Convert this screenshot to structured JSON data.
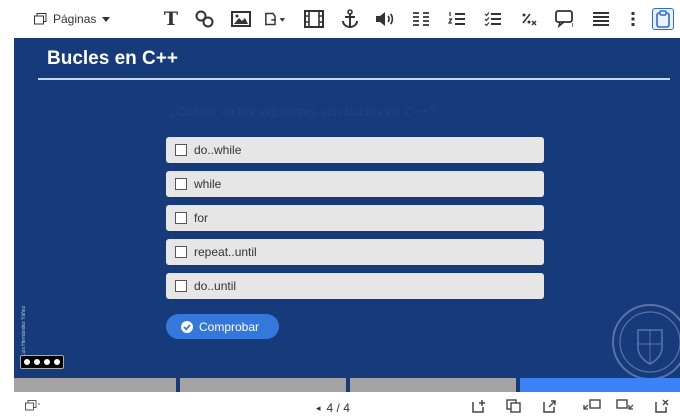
{
  "toolbar": {
    "pages_label": "Páginas",
    "text_tool_label": "T"
  },
  "slide": {
    "title": "Bucles en C++",
    "question": "¿Cuáles de los siguientes son bucles en C++?",
    "options": [
      {
        "label": "do..while"
      },
      {
        "label": "while"
      },
      {
        "label": "for"
      },
      {
        "label": "repeat..until"
      },
      {
        "label": "do..until"
      }
    ],
    "check_label": "Comprobar",
    "author": "Luis Hernández Yáñez",
    "license_badge": "BY NC SA"
  },
  "progress": {
    "segments": 4,
    "current": 4
  },
  "pager": {
    "text": "4 / 4",
    "prev_glyph": "◂"
  },
  "colors": {
    "slide_bg": "#163a7a",
    "option_bg": "#e6e6e6",
    "accent": "#3478dc",
    "progress_active": "#3b82f6",
    "progress_inactive": "#a3a3a3"
  }
}
